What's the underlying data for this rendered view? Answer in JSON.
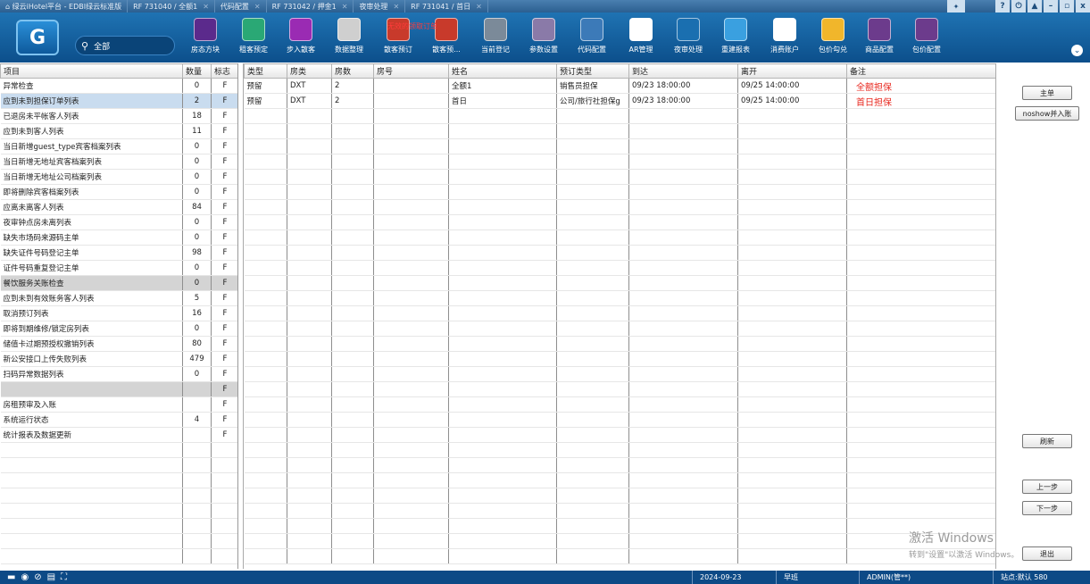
{
  "tabs": [
    {
      "label": "绿云iHotel平台 - EDBI绿云标准版"
    },
    {
      "label": "RF 731040 / 全额1"
    },
    {
      "label": "代码配置"
    },
    {
      "label": "RF 731042 / 押金1"
    },
    {
      "label": "夜审处理"
    },
    {
      "label": "RF 731041 / 首日"
    }
  ],
  "window_controls": {
    "pin": "✦",
    "help": "?",
    "power": "⏻",
    "user": "▲",
    "min": "–",
    "max": "▫",
    "close": "x"
  },
  "toolbar": {
    "logo": "G",
    "search_text": "全部",
    "red_label": "无效的领取订单",
    "expand": "⌄",
    "buttons": [
      {
        "label": "房态方块",
        "icon": "room-status-icon",
        "color": "#5b2a8c"
      },
      {
        "label": "租客预定",
        "icon": "person-icon",
        "color": "#2aa875"
      },
      {
        "label": "步入散客",
        "icon": "walkin-icon",
        "color": "#9a2bb3"
      },
      {
        "label": "数据整理",
        "icon": "disk-icon",
        "color": "#cfcfcf"
      },
      {
        "label": "散客预订",
        "icon": "contact-card-icon",
        "color": "#c83a2b"
      },
      {
        "label": "散客预...",
        "icon": "contact-card-icon",
        "color": "#c83a2b"
      },
      {
        "label": "当前登记",
        "icon": "ledger-icon",
        "color": "#7b8a99"
      },
      {
        "label": "参数设置",
        "icon": "gear-icon",
        "color": "#8a7aa8"
      },
      {
        "label": "代码配置",
        "icon": "code-icon",
        "color": "#3c7ab8"
      },
      {
        "label": "AR管理",
        "icon": "ar-icon",
        "color": "#ffffff"
      },
      {
        "label": "夜审处理",
        "icon": "moon-icon",
        "color": "#1a6fb0"
      },
      {
        "label": "重建报表",
        "icon": "refresh-icon",
        "color": "#3aa0e0"
      },
      {
        "label": "消费账户",
        "icon": "account-card-icon",
        "color": "#ffffff"
      },
      {
        "label": "包价勾兑",
        "icon": "check-box-icon",
        "color": "#f1b62b"
      },
      {
        "label": "商品配置",
        "icon": "cog-stack-icon",
        "color": "#6c3b8c"
      },
      {
        "label": "包价配置",
        "icon": "cog-stack-icon",
        "color": "#6c3b8c"
      }
    ]
  },
  "left_table": {
    "headers": [
      "项目",
      "数量",
      "标志"
    ],
    "rows": [
      {
        "item": "异常检查",
        "qty": "0",
        "flag": "F"
      },
      {
        "item": "应到未到担保订单列表",
        "qty": "2",
        "flag": "F"
      },
      {
        "item": "已退房未平帐客人列表",
        "qty": "18",
        "flag": "F"
      },
      {
        "item": "应到未到客人列表",
        "qty": "11",
        "flag": "F"
      },
      {
        "item": "当日新增guest_type宾客档案列表",
        "qty": "0",
        "flag": "F"
      },
      {
        "item": "当日新增无地址宾客档案列表",
        "qty": "0",
        "flag": "F"
      },
      {
        "item": "当日新增无地址公司档案列表",
        "qty": "0",
        "flag": "F"
      },
      {
        "item": "即将删除宾客档案列表",
        "qty": "0",
        "flag": "F"
      },
      {
        "item": "应离未离客人列表",
        "qty": "84",
        "flag": "F"
      },
      {
        "item": "夜审钟点房未离列表",
        "qty": "0",
        "flag": "F"
      },
      {
        "item": "缺失市场码来源码主单",
        "qty": "0",
        "flag": "F"
      },
      {
        "item": "缺失证件号码登记主单",
        "qty": "98",
        "flag": "F"
      },
      {
        "item": "证件号码重复登记主单",
        "qty": "0",
        "flag": "F"
      },
      {
        "item": "餐饮服务关账检查",
        "qty": "0",
        "flag": "F"
      },
      {
        "item": "应到未到有效账务客人列表",
        "qty": "5",
        "flag": "F"
      },
      {
        "item": "取消预订列表",
        "qty": "16",
        "flag": "F"
      },
      {
        "item": "即将到期维修/锁定房列表",
        "qty": "0",
        "flag": "F"
      },
      {
        "item": "储值卡过期预授权撤销列表",
        "qty": "80",
        "flag": "F"
      },
      {
        "item": "新公安接口上传失败列表",
        "qty": "479",
        "flag": "F"
      },
      {
        "item": "扫码异常数据列表",
        "qty": "0",
        "flag": "F"
      },
      {
        "item": "",
        "qty": "",
        "flag": "F"
      },
      {
        "item": "房租预审及入账",
        "qty": "",
        "flag": "F"
      },
      {
        "item": "系统运行状态",
        "qty": "4",
        "flag": "F"
      },
      {
        "item": "统计报表及数据更新",
        "qty": "",
        "flag": "F"
      }
    ]
  },
  "right_table": {
    "headers": [
      "类型",
      "房类",
      "房数",
      "房号",
      "姓名",
      "预订类型",
      "到达",
      "离开",
      "备注"
    ],
    "rows": [
      {
        "type": "预留",
        "room_type": "DXT",
        "rooms": "2",
        "room_no": "",
        "name": "全额1",
        "res_type": "销售员担保",
        "arrive": "09/23 18:00:00",
        "depart": "09/25 14:00:00",
        "note": "全额担保"
      },
      {
        "type": "预留",
        "room_type": "DXT",
        "rooms": "2",
        "room_no": "",
        "name": "首日",
        "res_type": "公司/旅行社担保g",
        "arrive": "09/23 18:00:00",
        "depart": "09/25 14:00:00",
        "note": "首日担保"
      }
    ]
  },
  "side_buttons": {
    "main": "主单",
    "noshow": "noshow并入账",
    "refresh": "刷新",
    "prev": "上一步",
    "next": "下一步",
    "exit": "退出"
  },
  "statusbar": {
    "icons": [
      "▬",
      "◉",
      "⊘",
      "▤",
      "⛶"
    ],
    "date": "2024-09-23",
    "shift": "早班",
    "user": "ADMIN(管**)",
    "extra": "站点:默认 580"
  },
  "watermark": {
    "title": "激活 Windows",
    "subtitle": "转到\"设置\"以激活 Windows。"
  }
}
